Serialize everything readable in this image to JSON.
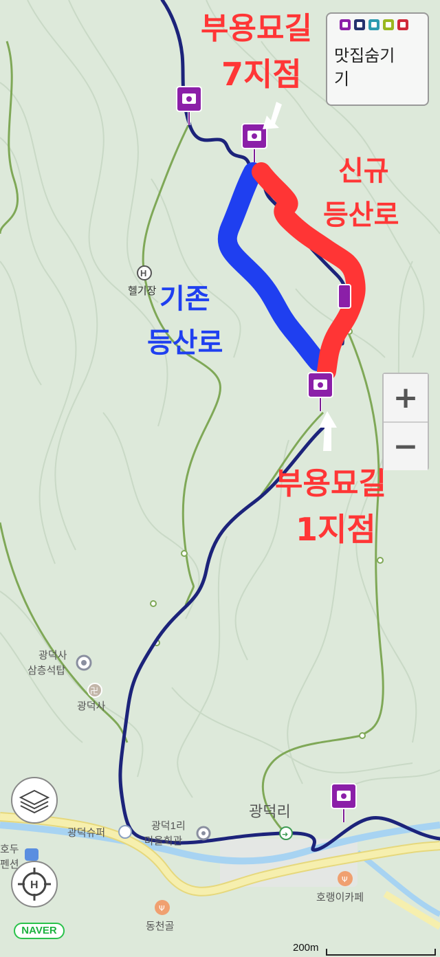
{
  "annotations": {
    "top_right_line1": "부용묘길",
    "top_right_line2": "7지점",
    "new_trail_line1": "신규",
    "new_trail_line2": "등산로",
    "old_trail_line1": "기존",
    "old_trail_line2": "등산로",
    "bottom_line1": "부용묘길",
    "bottom_line2": "1지점"
  },
  "places": {
    "heliport": "헬기장",
    "pagoda_line1": "광덕사",
    "pagoda_line2": "삼층석탑",
    "temple": "광덕사",
    "village": "광덕리",
    "store": "광덕슈퍼",
    "hall_line1": "광덕1리",
    "hall_line2": "마을회관",
    "pension_line1": "호두",
    "pension_line2": "펜션",
    "cafe": "호랭이카페",
    "restaurant": "동천골"
  },
  "legend": {
    "text_line1": "맛집숨기",
    "text_line2": "기",
    "icon_colors": [
      "#8b1fa8",
      "#24326e",
      "#2c9bb0",
      "#9ab820",
      "#d02a3a"
    ]
  },
  "controls": {
    "zoom_in": "+",
    "zoom_out": "−"
  },
  "brand": "NAVER",
  "scale_label": "200m",
  "colors": {
    "route_navy": "#1c237a",
    "trail_green": "#7fa857",
    "new_trail": "#ff3535",
    "old_trail": "#1f3ff0",
    "marker": "#8b1fa8",
    "stream": "#a7d3f2",
    "road": "#f3ea9a"
  }
}
